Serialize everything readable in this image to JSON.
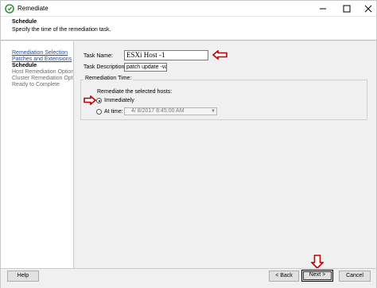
{
  "window": {
    "title": "Remediate",
    "controls": {
      "minimize": "minimize-icon",
      "maximize": "maximize-icon",
      "close": "close-icon"
    }
  },
  "header": {
    "title": "Schedule",
    "subtitle": "Specify the time of the remediation task."
  },
  "sidebar": {
    "items": [
      {
        "label": "Remediation Selection",
        "state": "link"
      },
      {
        "label": "Patches and Extensions",
        "state": "link"
      },
      {
        "label": "Schedule",
        "state": "active"
      },
      {
        "label": "Host Remediation Options",
        "state": "disabled"
      },
      {
        "label": "Cluster Remediation Options",
        "state": "disabled"
      },
      {
        "label": "Ready to Complete",
        "state": "disabled"
      }
    ]
  },
  "form": {
    "task_name_label": "Task Name:",
    "task_name_value": "ESXi Host -1",
    "task_description_label": "Task Description:",
    "task_description_value": "patch update -va-fw",
    "remediation_time_label": "Remediation Time:",
    "remediate_hosts_label": "Remediate the selected hosts:",
    "immediately_label": "Immediately",
    "at_time_label": "At time:",
    "at_time_value": "4/  8/2017   8:45:00 AM",
    "selected_option": "immediately"
  },
  "footer": {
    "help_label": "Help",
    "back_label": "< Back",
    "next_label": "Next >",
    "cancel_label": "Cancel"
  },
  "colors": {
    "annotation_red": "#c00000",
    "link_blue": "#1f4e9c",
    "app_icon_green": "#3a8f3a"
  }
}
